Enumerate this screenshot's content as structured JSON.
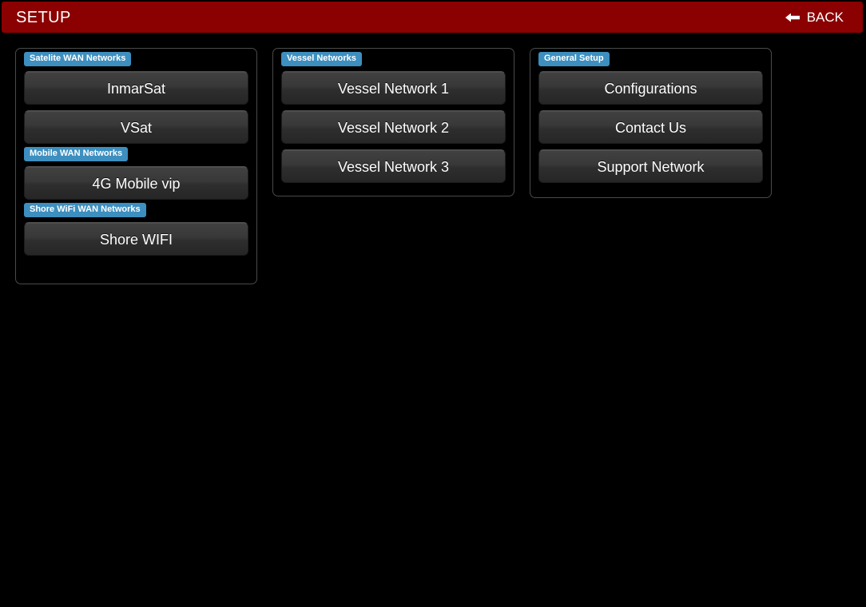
{
  "header": {
    "title": "SETUP",
    "back_label": "BACK",
    "back_icon": "arrow-left-icon",
    "background_color": "#8b0000",
    "text_color": "#ffffff"
  },
  "theme": {
    "page_background": "#000000",
    "panel_border": "#4a4a4a",
    "chip_color": "#3d8fbf",
    "button_color": "#383838"
  },
  "panels": [
    {
      "id": "wan-networks",
      "groups": [
        {
          "label": "Satelite WAN Networks",
          "buttons": [
            {
              "label": "InmarSat"
            },
            {
              "label": "VSat"
            }
          ]
        },
        {
          "label": "Mobile WAN Networks",
          "buttons": [
            {
              "label": "4G Mobile vip"
            }
          ]
        },
        {
          "label": "Shore WiFi WAN Networks",
          "buttons": [
            {
              "label": "Shore WIFI"
            }
          ]
        }
      ]
    },
    {
      "id": "vessel-networks",
      "groups": [
        {
          "label": "Vessel Networks",
          "buttons": [
            {
              "label": "Vessel Network 1"
            },
            {
              "label": "Vessel Network 2"
            },
            {
              "label": "Vessel Network 3"
            }
          ]
        }
      ]
    },
    {
      "id": "general-setup",
      "groups": [
        {
          "label": "General Setup",
          "buttons": [
            {
              "label": "Configurations"
            },
            {
              "label": "Contact Us"
            },
            {
              "label": "Support Network"
            }
          ]
        }
      ]
    }
  ]
}
